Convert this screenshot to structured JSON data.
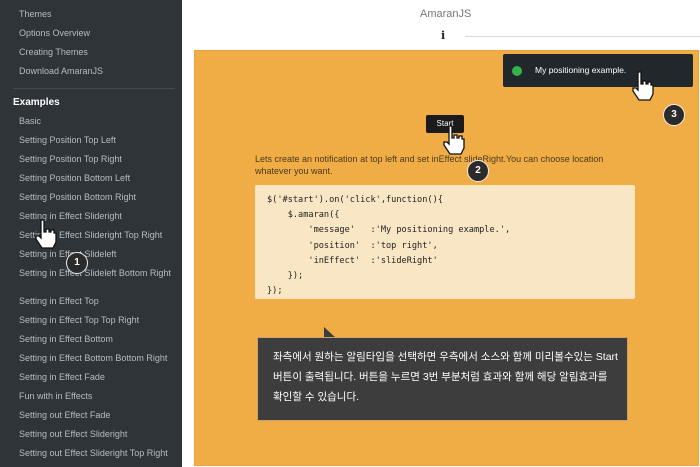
{
  "sidebar": {
    "top_items": [
      "Themes",
      "Options Overview",
      "Creating Themes",
      "Download AmaranJS"
    ],
    "examples_heading": "Examples",
    "examples": [
      "Basic",
      "Setting Position Top Left",
      "Setting Position Top Right",
      "Setting Position Bottom Left",
      "Setting Position Bottom Right",
      "Setting in Effect Slideright",
      "Setting in Effect Slideright Top Right",
      "Setting in Effect Slideleft",
      "Setting in Effect Slideleft Bottom Right",
      "Setting in Effect Top",
      "Setting in Effect Top Top Right",
      "Setting in Effect Bottom",
      "Setting in Effect Bottom Bottom Right",
      "Setting in Effect Fade",
      "Fun with in Effects",
      "Setting out Effect Fade",
      "Setting out Effect Slideright",
      "Setting out Effect Slideright Top Right"
    ]
  },
  "header": {
    "title": "AmaranJS",
    "info_icon": "i"
  },
  "demo": {
    "start_label": "Start",
    "description": "Lets create an notification at top left and set inEffect slideRight.You can choose location whatever you want.",
    "code": "$('#start').on('click',function(){\n    $.amaran({\n        'message'   :'My positioning example.',\n        'position'  :'top right',\n        'inEffect'  :'slideRight'\n    });\n});"
  },
  "toast": {
    "message": "My positioning example.",
    "dot_color": "#35b34a"
  },
  "tooltip": {
    "text": "좌측에서 원하는 알림타입을 선택하면 우측에서 소스와 함께 미리볼수있는 Start버튼이 출력됩니다. 버튼을 누르면 3번 부분처럼 효과와 함께 해당 알림효과를 확인할 수 있습니다."
  },
  "badges": [
    "1",
    "2",
    "3"
  ],
  "colors": {
    "sidebar": "#2f3439",
    "demo_bg": "#f0ad45",
    "code_bg": "#f8e6c4"
  }
}
